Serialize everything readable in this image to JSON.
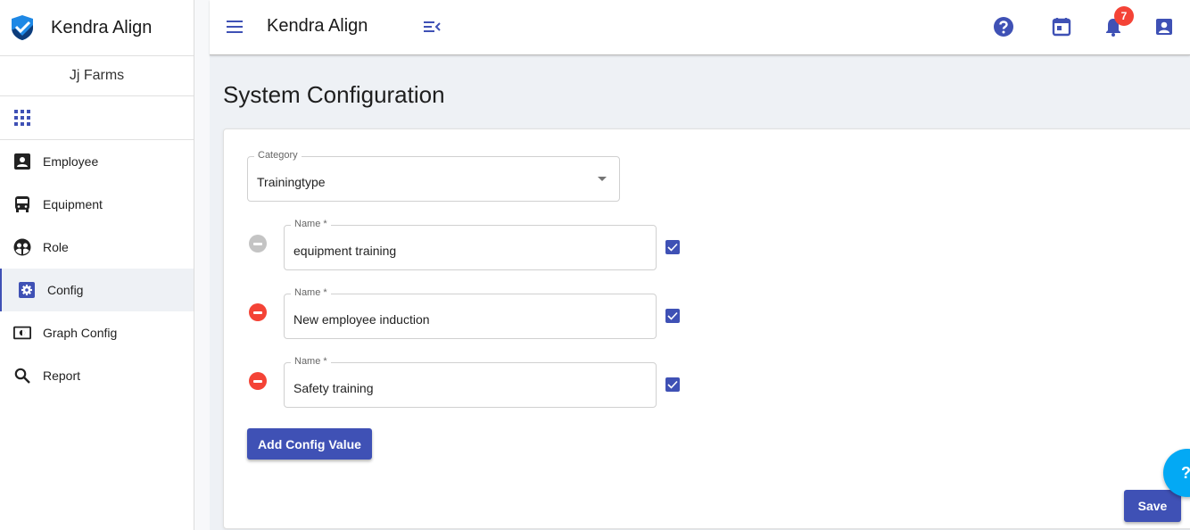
{
  "app": {
    "name": "Kendra Align",
    "organization": "Jj Farms"
  },
  "sidebar": {
    "items": [
      {
        "label": "Employee",
        "icon": "account-box-icon",
        "active": false
      },
      {
        "label": "Equipment",
        "icon": "bus-icon",
        "active": false
      },
      {
        "label": "Role",
        "icon": "group-circle-icon",
        "active": false
      },
      {
        "label": "Config",
        "icon": "settings-box-icon",
        "active": true
      },
      {
        "label": "Graph Config",
        "icon": "brightness-box-icon",
        "active": false
      },
      {
        "label": "Report",
        "icon": "search-icon",
        "active": false
      }
    ]
  },
  "topbar": {
    "title": "Kendra Align",
    "notifications_count": "7",
    "icons": [
      "help-icon",
      "calendar-icon",
      "bell-icon",
      "account-box-icon"
    ]
  },
  "page": {
    "title": "System Configuration"
  },
  "form": {
    "category_label": "Category",
    "category_value": "Trainingtype",
    "rows": [
      {
        "label": "Name *",
        "value": "equipment training",
        "removable": false,
        "checked": true
      },
      {
        "label": "Name *",
        "value": "New employee induction",
        "removable": true,
        "checked": true
      },
      {
        "label": "Name *",
        "value": "Safety training",
        "removable": true,
        "checked": true
      }
    ],
    "add_button": "Add Config Value",
    "save_button": "Save"
  },
  "help_fab": "?",
  "colors": {
    "primary": "#3f51b5",
    "danger": "#f44336",
    "disabled": "#c4c4c4",
    "fab": "#03a9f4",
    "background": "#eef1f5"
  }
}
